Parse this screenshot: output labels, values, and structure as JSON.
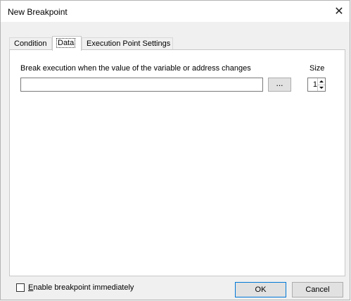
{
  "window": {
    "title": "New Breakpoint",
    "close_icon": "close-icon"
  },
  "tabs": [
    {
      "label": "Condition",
      "active": false
    },
    {
      "label": "Data",
      "active": true
    },
    {
      "label": "Execution Point Settings",
      "active": false
    }
  ],
  "data_tab": {
    "description": "Break execution when the value of the variable or address changes",
    "expression_value": "",
    "browse_label": "...",
    "size_label": "Size",
    "size_value": "1"
  },
  "footer": {
    "enable_checkbox": {
      "label_underline": "E",
      "label_rest": "nable breakpoint immediately",
      "checked": false
    },
    "ok_label": "OK",
    "cancel_label": "Cancel"
  },
  "colors": {
    "default_button_border": "#0078d7",
    "panel_background": "#ffffff",
    "dialog_background": "#f0f0f0"
  }
}
